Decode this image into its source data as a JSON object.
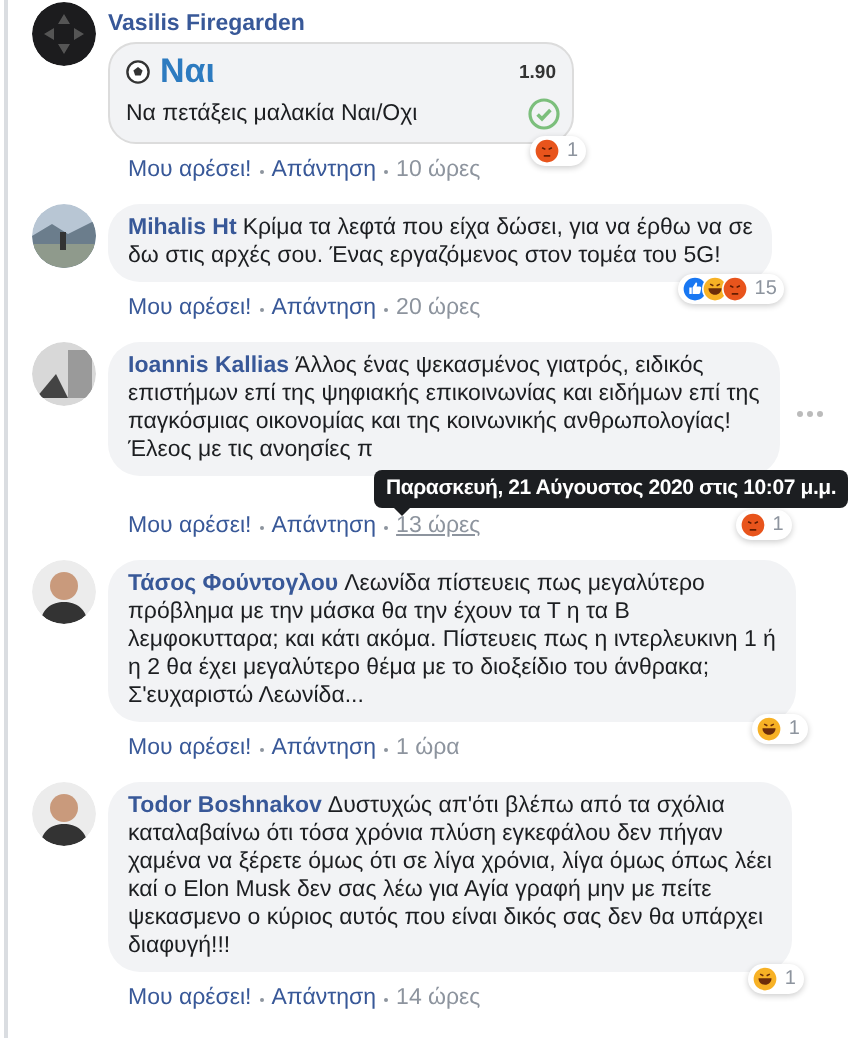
{
  "comments": [
    {
      "author": "Vasilis Firegarden",
      "bet": {
        "pick": "Ναι",
        "odds": "1.90",
        "market": "Να πετάξεις μαλακία Ναι/Οχι",
        "won": true
      },
      "reactions": [
        {
          "kind": "angry"
        }
      ],
      "reaction_count": "1",
      "actions": {
        "like": "Μου αρέσει!",
        "reply": "Απάντηση",
        "time": "10 ώρες"
      },
      "time_hovered": false
    },
    {
      "author": "Mihalis Ht",
      "lines": [
        "Κρίμα τα λεφτά που είχα δώσει, για να έρθω να σε",
        "δω στις αρχές σου. Ένας εργαζόμενος στον τομέα του 5G!"
      ],
      "reactions": [
        {
          "kind": "like"
        },
        {
          "kind": "haha"
        },
        {
          "kind": "angry"
        }
      ],
      "reaction_count": "15",
      "actions": {
        "like": "Μου αρέσει!",
        "reply": "Απάντηση",
        "time": "20 ώρες"
      },
      "time_hovered": false
    },
    {
      "author": "Ioannis Kallias",
      "lines": [
        "Άλλος ένας ψεκασμένος γιατρός, ειδικός",
        "επιστήμων επί της ψηφιακής επικοινωνίας και ειδήμων επί της",
        "παγκόσμιας οικονομίας και της κοινωνικής ανθρωπολογίας!",
        "Έλεος με τις ανοησίες π"
      ],
      "reactions": [
        {
          "kind": "angry"
        }
      ],
      "reaction_count": "1",
      "actions": {
        "like": "Μου αρέσει!",
        "reply": "Απάντηση",
        "time": "13 ώρες"
      },
      "time_hovered": true,
      "tooltip": "Παρασκευή, 21 Αύγουστος 2020 στις 10:07 μ.μ.",
      "more": true
    },
    {
      "author": "Τάσος Φούντογλου",
      "lines": [
        "Λεωνίδα πίστευεις πως μεγαλύτερο",
        "πρόβλημα με την μάσκα θα την έχουν τα Τ η τα Β",
        "λεμφοκυτταρα; και κάτι ακόμα. Πίστευεις πως η ιντερλευκινη 1 ή",
        "η 2 θα έχει μεγαλύτερο θέμα με το διοξείδιο του άνθρακα;",
        "Σ'ευχαριστώ Λεωνίδα..."
      ],
      "reactions": [
        {
          "kind": "haha"
        }
      ],
      "reaction_count": "1",
      "actions": {
        "like": "Μου αρέσει!",
        "reply": "Απάντηση",
        "time": "1 ώρα"
      },
      "time_hovered": false
    },
    {
      "author": "Todor Boshnakov",
      "lines": [
        "Δυστυχώς απ'ότι βλέπω από τα σχόλια",
        "καταλαβαίνω ότι τόσα χρόνια πλύση εγκεφάλου δεν πήγαν",
        "χαμένα να ξέρετε όμως ότι σε λίγα χρόνια, λίγα όμως όπως λέει",
        "καί ο Elon Musk δεν σας λέω για Αγία γραφή μην με πείτε",
        "ψεκασμενο ο κύριος αυτός που είναι δικός σας δεν θα υπάρχει",
        "διαφυγή!!!"
      ],
      "reactions": [
        {
          "kind": "haha"
        }
      ],
      "reaction_count": "1",
      "actions": {
        "like": "Μου αρέσει!",
        "reply": "Απάντηση",
        "time": "14 ώρες"
      },
      "time_hovered": false
    }
  ]
}
